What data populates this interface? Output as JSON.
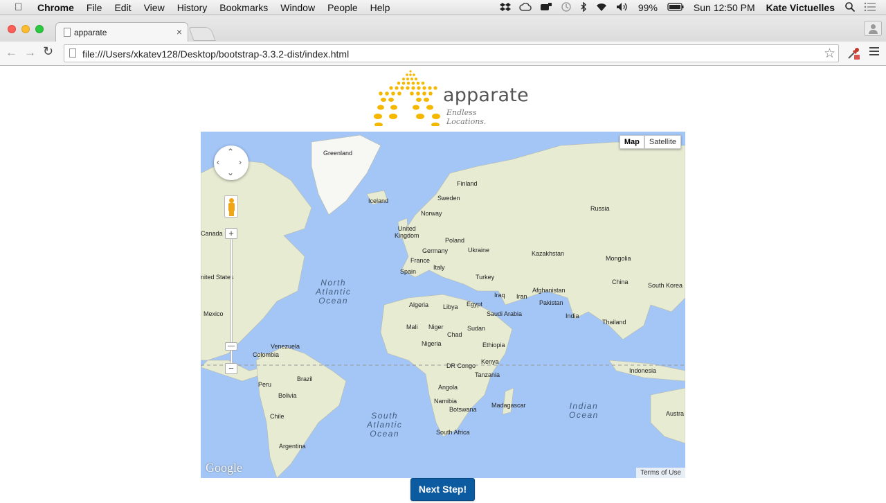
{
  "menubar": {
    "apple_icon": "apple-logo-icon",
    "items": [
      "Chrome",
      "File",
      "Edit",
      "View",
      "History",
      "Bookmarks",
      "Window",
      "People",
      "Help"
    ],
    "battery": "99%",
    "clock": "Sun 12:50 PM",
    "user": "Kate Victuelles",
    "status_icons": [
      "dropbox-icon",
      "creative-cloud-icon",
      "bluetooth-device-icon",
      "time-machine-icon",
      "bluetooth-icon",
      "wifi-icon",
      "volume-icon",
      "battery-icon",
      "spotlight-icon",
      "notification-center-icon"
    ]
  },
  "browser": {
    "tab_title": "apparate",
    "tab_close": "×",
    "url": "file:///Users/xkatev128/Desktop/bootstrap-3.3.2-dist/index.html"
  },
  "logo": {
    "wordmark": "apparate",
    "tagline": "Endless Locations."
  },
  "map": {
    "type_buttons": [
      "Map",
      "Satellite"
    ],
    "active_type": "Map",
    "attribution": "Google",
    "terms": "Terms of Use",
    "zoom_in": "+",
    "zoom_out": "−",
    "labels": {
      "greenland": "Greenland",
      "iceland": "Iceland",
      "finland": "Finland",
      "sweden": "Sweden",
      "norway": "Norway",
      "russia": "Russia",
      "united_kingdom": "United\nKingdom",
      "poland": "Poland",
      "germany": "Germany",
      "ukraine": "Ukraine",
      "france": "France",
      "kazakhstan": "Kazakhstan",
      "mongolia": "Mongolia",
      "canada": "Canada",
      "spain": "Spain",
      "italy": "Italy",
      "turkey": "Turkey",
      "united_states": "nited States",
      "china": "China",
      "south_korea": "South Korea",
      "afghanistan": "Afghanistan",
      "iraq": "Iraq",
      "iran": "Iran",
      "algeria": "Algeria",
      "libya": "Libya",
      "egypt": "Egypt",
      "pakistan": "Pakistan",
      "mexico": "Mexico",
      "saudi_arabia": "Saudi Arabia",
      "india": "India",
      "thailand": "Thailand",
      "mali": "Mali",
      "niger": "Niger",
      "sudan": "Sudan",
      "chad": "Chad",
      "nigeria": "Nigeria",
      "ethiopia": "Ethiopia",
      "venezuela": "Venezuela",
      "colombia": "Colombia",
      "kenya": "Kenya",
      "dr_congo": "DR Congo",
      "indonesia": "Indonesia",
      "tanzania": "Tanzania",
      "brazil": "Brazil",
      "peru": "Peru",
      "angola": "Angola",
      "bolivia": "Bolivia",
      "namibia": "Namibia",
      "madagascar": "Madagascar",
      "botswana": "Botswana",
      "chile": "Chile",
      "south_africa": "South Africa",
      "argentina": "Argentina",
      "australia": "Austra"
    },
    "oceans": {
      "north_atlantic": "North\nAtlantic\nOcean",
      "south_atlantic": "South\nAtlantic\nOcean",
      "indian": "Indian\nOcean"
    }
  },
  "actions": {
    "next_label": "Next Step!"
  },
  "colors": {
    "brand_gold": "#f5b800",
    "button_blue": "#0c5aa0",
    "ocean": "#a3c6f6",
    "land": "#e8ecd4"
  }
}
